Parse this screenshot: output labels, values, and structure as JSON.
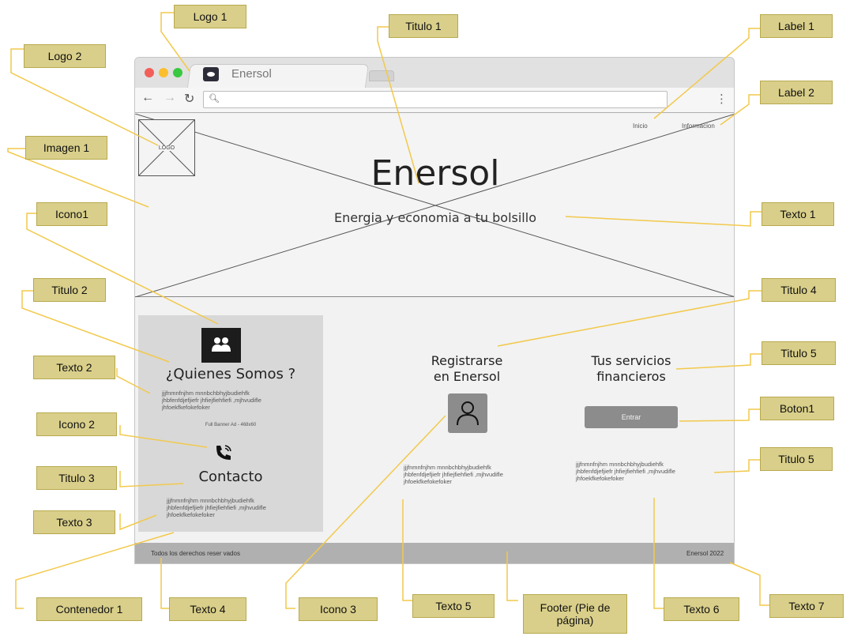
{
  "callouts": {
    "logo1": "Logo 1",
    "logo2": "Logo 2",
    "titulo1": "Titulo 1",
    "label1": "Label 1",
    "label2": "Label 2",
    "imagen1": "Imagen 1",
    "icono1": "Icono1",
    "texto1": "Texto 1",
    "titulo2": "Titulo 2",
    "titulo4": "Titulo 4",
    "texto2": "Texto 2",
    "titulo5a": "Titulo 5",
    "icono2": "Icono 2",
    "boton1": "Boton1",
    "titulo3": "Titulo 3",
    "titulo5b": "Titulo 5",
    "texto3": "Texto 3",
    "contenedor1": "Contenedor 1",
    "texto4": "Texto 4",
    "icono3": "Icono 3",
    "texto5": "Texto 5",
    "footer": "Footer (Pie de página)",
    "texto6": "Texto 6",
    "texto7": "Texto 7"
  },
  "browser": {
    "tab_title": "Enersol"
  },
  "hero": {
    "logo_label": "LOGO",
    "nav_inicio": "Inicio",
    "nav_informacion": "Informacion",
    "title": "Enersol",
    "subtitle": "Energia y economia a tu bolsillo"
  },
  "card": {
    "title": "¿Quienes Somos ?",
    "text": "jjjfnmnfnjhm mnnbchbhyjbudiehfk\njhbfenfdjefjiefr jhfiejfiehfiefi ,mjhvudifle\njhfoekfkefokefoker",
    "banner": "Full Banner Ad - 468x60",
    "contact_title": "Contacto",
    "contact_text": "jjjfnmnfnjhm mnnbchbhyjbudiehfk\njhbfenfdjefjiefr jhfiejfiehfiefi ,mjhvudifle\njhfoekfkefokefoker"
  },
  "register": {
    "title": "Registrarse\nen Enersol",
    "text": "jjjfnmnfnjhm mnnbchbhyjbudiehfk\njhbfenfdjefjiefr jhfiejfiehfiefi ,mjhvudifle\njhfoekfkefokefoker"
  },
  "services": {
    "title": "Tus servicios\nfinancieros",
    "button": "Entrar",
    "text": "jjjfnmnfnjhm mnnbchbhyjbudiehfk\njhbfenfdjefjiefr jhfiejfiehfiefi ,mjhvudifle\njhfoekfkefokefoker"
  },
  "footer": {
    "left": "Todos los derechos reser vados",
    "right": "Enersol 2022"
  },
  "colors": {
    "callout": "#d9cf8a",
    "leader": "#f2c94c",
    "wireframe_bg": "#f2f2f2",
    "container": "#d8d8d8",
    "footer": "#b0b0b0"
  }
}
